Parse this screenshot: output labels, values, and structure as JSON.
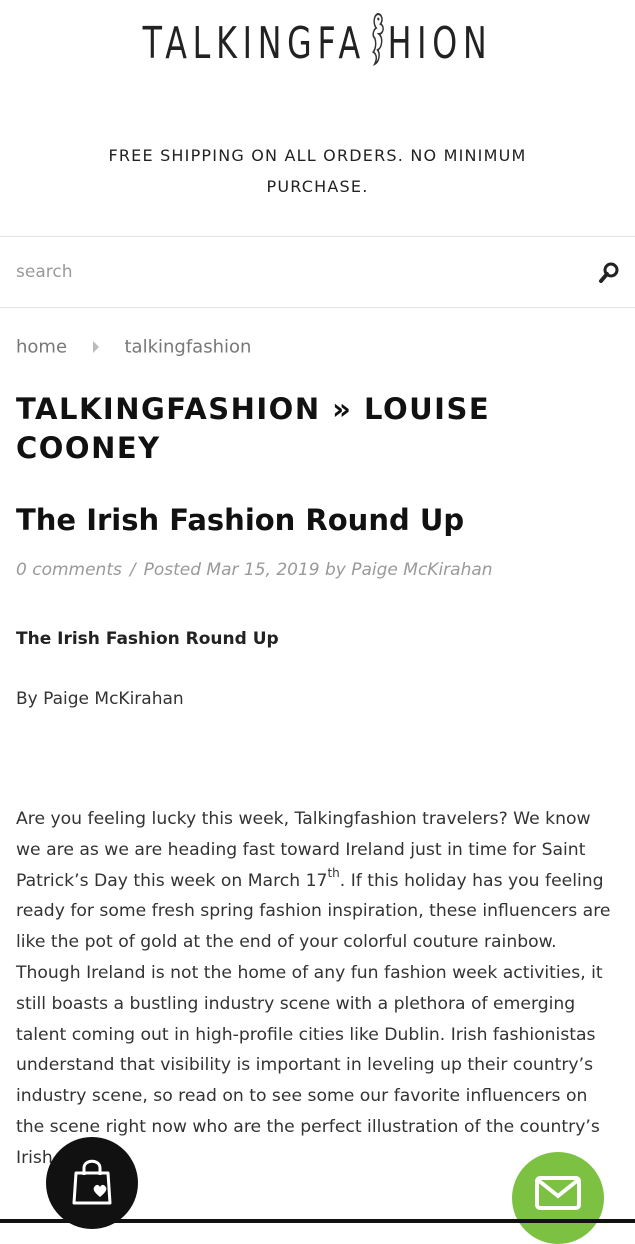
{
  "header": {
    "logo_text_left": "TALKINGFA",
    "logo_text_right": "HION"
  },
  "promo": {
    "line1": "FREE SHIPPING ON ALL ORDERS. NO MINIMUM",
    "line2": "PURCHASE."
  },
  "search": {
    "placeholder": "search",
    "icon": "search-icon"
  },
  "breadcrumb": {
    "items": [
      "home",
      "talkingfashion"
    ]
  },
  "blog": {
    "title_line1": "TALKINGFASHION » LOUISE",
    "title_line2": "COONEY"
  },
  "article": {
    "title": "The Irish Fashion Round Up",
    "comments": "0 comments",
    "posted": "Posted Mar 15, 2019 by Paige McKirahan",
    "subhead": "The Irish Fashion Round Up",
    "byline": "By Paige McKirahan",
    "body_part1": "Are you feeling lucky this week, Talkingfashion travelers? We know we are as we are heading fast toward Ireland just in time for Saint Patrick’s Day this week on March 17",
    "body_sup": "th",
    "body_part2": ". If this holiday has you feeling ready for some fresh spring fashion inspiration, these influencers are like the pot of gold at the end of your colorful couture rainbow. Though Ireland is not the home of any fun fashion week activities, it still boasts a bustling industry scene with a plethora of emerging talent coming out in high-profile cities like Dublin. Irish fashionistas understand that visibility is important in leveling up their country’s industry scene, so read on to see some our favorite influencers on the scene right now who are the perfect illustration of the country’s Irish charm."
  },
  "fabs": {
    "cart_icon": "shopping-bag-heart-icon",
    "mail_icon": "envelope-icon",
    "cart_color": "#111111",
    "mail_color": "#7dc142"
  }
}
